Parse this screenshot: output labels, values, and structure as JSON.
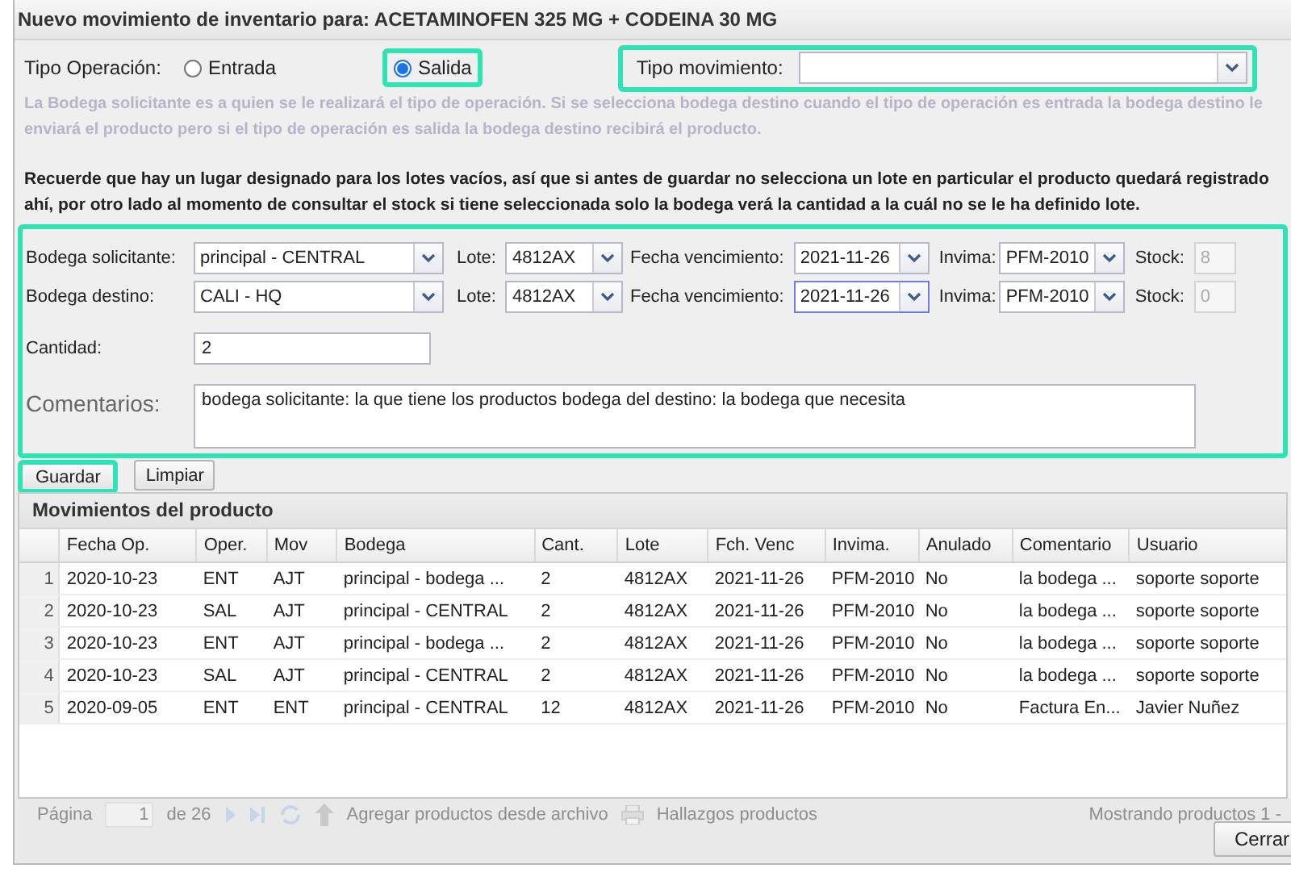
{
  "dialog": {
    "title": "Nuevo movimiento de inventario para: ACETAMINOFEN 325 MG + CODEINA 30 MG"
  },
  "operation": {
    "label": "Tipo Operación:",
    "options": [
      {
        "label": "Entrada",
        "selected": false,
        "highlighted": false
      },
      {
        "label": "Salida",
        "selected": true,
        "highlighted": true
      }
    ]
  },
  "movement_type": {
    "label": "Tipo movimiento:",
    "highlighted": true
  },
  "hint": "La Bodega solicitante es a quien se le realizará el tipo de operación. Si se selecciona bodega destino cuando el tipo de operación es entrada la bodega destino le enviará el producto pero si el tipo de operación es salida la bodega destino recibirá el producto.",
  "notice": "Recuerde que hay un lugar designado para los lotes vacíos, así que si antes de guardar no selecciona un lote en particular el producto quedará registrado ahí, por otro lado al momento de consultar el stock si tiene seleccionada solo la bodega verá la cantidad a la cuál no se le ha definido lote.",
  "form": {
    "highlighted": true,
    "rows": [
      {
        "warehouse_label": "Bodega solicitante:",
        "warehouse": "principal - CENTRAL",
        "lot_label": "Lote:",
        "lot": "4812AX",
        "expiry_label": "Fecha vencimiento:",
        "expiry": "2021-11-26",
        "focused": false,
        "invima_label": "Invima:",
        "invima": "PFM-2010",
        "stock_label": "Stock:",
        "stock": "8"
      },
      {
        "warehouse_label": "Bodega destino:",
        "warehouse": "CALI - HQ",
        "lot_label": "Lote:",
        "lot": "4812AX",
        "expiry_label": "Fecha vencimiento:",
        "expiry": "2021-11-26",
        "focused": true,
        "invima_label": "Invima:",
        "invima": "PFM-2010",
        "stock_label": "Stock:",
        "stock": "0"
      }
    ],
    "quantity": {
      "label": "Cantidad:",
      "value": "2"
    },
    "comments": {
      "label": "Comentarios:",
      "value": "bodega solicitante: la que tiene los productos bodega del destino: la bodega que necesita"
    }
  },
  "buttons": [
    {
      "label": "Guardar",
      "highlighted": true
    },
    {
      "label": "Limpiar",
      "highlighted": false
    }
  ],
  "grid": {
    "title": "Movimientos del producto",
    "columns": [
      "Fecha Op.",
      "Oper.",
      "Mov",
      "Bodega",
      "Cant.",
      "Lote",
      "Fch. Venc",
      "Invima.",
      "Anulado",
      "Comentario",
      "Usuario"
    ],
    "rows": [
      {
        "number": "1",
        "cells": [
          "2020-10-23",
          "ENT",
          "AJT",
          "principal - bodega ...",
          "2",
          "4812AX",
          "2021-11-26",
          "PFM-2010",
          "No",
          "la bodega ...",
          "soporte soporte"
        ]
      },
      {
        "number": "2",
        "cells": [
          "2020-10-23",
          "SAL",
          "AJT",
          "principal - CENTRAL",
          "2",
          "4812AX",
          "2021-11-26",
          "PFM-2010",
          "No",
          "la bodega ...",
          "soporte soporte"
        ]
      },
      {
        "number": "3",
        "cells": [
          "2020-10-23",
          "ENT",
          "AJT",
          "principal - bodega ...",
          "2",
          "4812AX",
          "2021-11-26",
          "PFM-2010",
          "No",
          "la bodega ...",
          "soporte soporte"
        ]
      },
      {
        "number": "4",
        "cells": [
          "2020-10-23",
          "SAL",
          "AJT",
          "principal - CENTRAL",
          "2",
          "4812AX",
          "2021-11-26",
          "PFM-2010",
          "No",
          "la bodega ...",
          "soporte soporte"
        ]
      },
      {
        "number": "5",
        "cells": [
          "2020-09-05",
          "ENT",
          "ENT",
          "principal - CENTRAL",
          "12",
          "4812AX",
          "2021-11-26",
          "PFM-2010",
          "No",
          "Factura En...",
          "Javier Nuñez"
        ]
      }
    ]
  },
  "background_toolbar": {
    "page_label": "Página",
    "page": "1",
    "page_total": "de 26",
    "import_label": "Agregar productos desde archivo",
    "report_label": "Hallazgos productos",
    "status": "Mostrando productos 1 -"
  },
  "close_button": "Cerrar"
}
